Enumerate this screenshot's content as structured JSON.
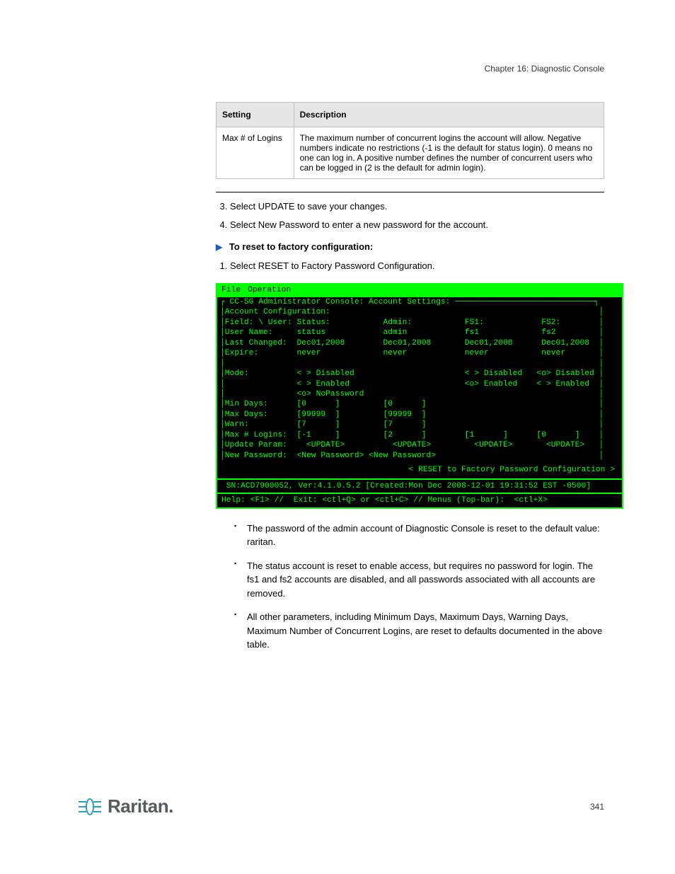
{
  "chapter": "Chapter 16: Diagnostic Console",
  "setting_table": {
    "h1": "Setting",
    "h2": "Description",
    "r1c1": "Max # of Logins",
    "r1c2": "The maximum number of concurrent logins the account will allow. Negative numbers indicate no restrictions (-1 is the default for status login). 0 means no one can log in. A positive number defines the number of concurrent users who can be logged in (2 is the default for admin login)."
  },
  "steps_top": {
    "s3": "Select UPDATE to save your changes.",
    "s4": "Select New Password to enter a new password for the account."
  },
  "note_line": " ",
  "proc_title": "To reset to factory configuration:",
  "steps_proc": {
    "s1": "Select RESET to Factory Password Configuration."
  },
  "terminal": {
    "menu_file": "File",
    "menu_op": "Operation",
    "title_line": "┌ CC-SG Administrator Console: Account Settings: ─────────────────────────────┐",
    "l1": "│Account Configuration:                                                        │",
    "l2": "│Field: \\ User: Status:           Admin:           FS1:            FS2:        │",
    "l3": "│User Name:     status            admin            fs1             fs2         │",
    "l4": "│Last Changed:  Dec01,2008        Dec01,2008       Dec01,2008      Dec01,2008  │",
    "l5": "│Expire:        never             never            never           never       │",
    "l6": "│                                                                              │",
    "l7": "│Mode:          < > Disabled                       < > Disabled   <o> Disabled │",
    "l8": "│               < > Enabled                        <o> Enabled    < > Enabled  │",
    "l9": "│               <o> NoPassword                                                 │",
    "l10": "│Min Days:      [0      ]         [0      ]                                    │",
    "l11": "│Max Days:      [99999  ]         [99999  ]                                    │",
    "l12": "│Warn:          [7      ]         [7      ]                                    │",
    "l13": "│Max # Logins:  [-1     ]         [2      ]        [1      ]      [0      ]    │",
    "l14": "│Update Param:    <UPDATE>          <UPDATE>         <UPDATE>       <UPDATE>   │",
    "l15": "│New Password:  <New Password> <New Password>                                  │",
    "reset": "< RESET to Factory Password Configuration >",
    "footer": " SN:ACD7900052, Ver:4.1.0.5.2 [Created:Mon Dec 2008-12-01 19:31:52 EST -0500]",
    "help": "Help: <F1> //  Exit: <ctl+Q> or <ctl+C> // Menus (Top-bar):  <ctl+X>"
  },
  "bullets": {
    "b1": "The password of the admin account of Diagnostic Console is reset to the default value: raritan.",
    "b2": "The status account is reset to enable access, but requires no password for login. The fs1 and fs2 accounts are disabled, and all passwords associated with all accounts are removed.",
    "b3": "All other parameters, including Minimum Days, Maximum Days, Warning Days, Maximum Number of Concurrent Logins, are reset to defaults documented in the above table."
  },
  "page_number": "341",
  "logo_text": "Raritan."
}
